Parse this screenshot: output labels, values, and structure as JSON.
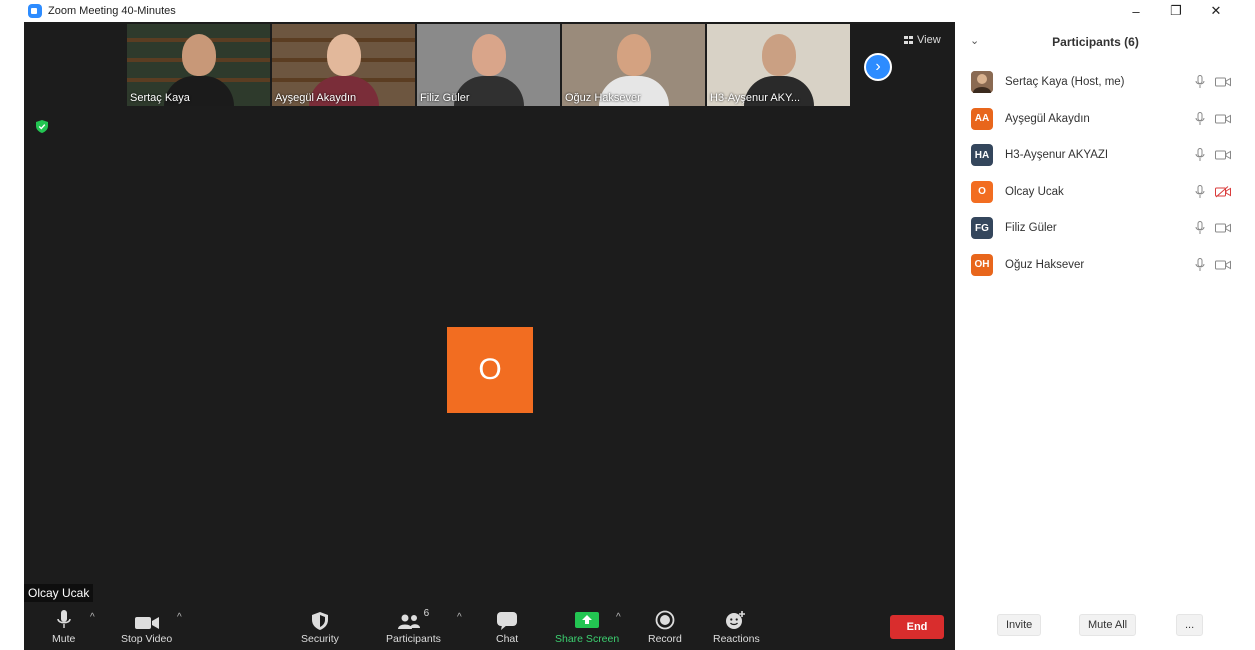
{
  "window": {
    "title": "Zoom Meeting 40-Minutes",
    "controls": [
      "–",
      "❐",
      "✕"
    ]
  },
  "gallery": {
    "tiles": [
      {
        "name": "Sertaç Kaya",
        "bg": "#2e3a2c",
        "shirt": "#1b1b1b",
        "skin": "#c89878"
      },
      {
        "name": "Ayşegül Akaydın",
        "bg": "#6d5640",
        "shirt": "#7a2d39",
        "skin": "#e2b89b"
      },
      {
        "name": "Filiz Güler",
        "bg": "#8a8a8a",
        "shirt": "#303030",
        "skin": "#d9a58a"
      },
      {
        "name": "Oğuz Haksever",
        "bg": "#9a8b7b",
        "shirt": "#e6e6e6",
        "skin": "#d4a281"
      },
      {
        "name": "H3-Ayşenur AKY...",
        "bg": "#d8d2c6",
        "shirt": "#2a2a2a",
        "skin": "#caa083"
      }
    ],
    "view_label": "View"
  },
  "main_video": {
    "avatar_letter": "O",
    "avatar_color": "#f26d21",
    "speaker_name": "Olcay Ucak"
  },
  "toolbar": {
    "mute": "Mute",
    "stop_video": "Stop Video",
    "security": "Security",
    "participants": "Participants",
    "participants_count": "6",
    "chat": "Chat",
    "share_screen": "Share Screen",
    "record": "Record",
    "reactions": "Reactions",
    "end": "End"
  },
  "panel": {
    "title": "Participants (6)",
    "participants": [
      {
        "initials": "",
        "name": "Sertaç Kaya (Host, me)",
        "color": "#8a6a52",
        "video_off": false
      },
      {
        "initials": "AA",
        "name": "Ayşegül Akaydın",
        "color": "#e8661c",
        "video_off": false
      },
      {
        "initials": "HA",
        "name": "H3-Ayşenur AKYAZI",
        "color": "#34465c",
        "video_off": false
      },
      {
        "initials": "O",
        "name": "Olcay Ucak",
        "color": "#f26d21",
        "video_off": true
      },
      {
        "initials": "FG",
        "name": "Filiz Güler",
        "color": "#34465c",
        "video_off": false
      },
      {
        "initials": "OH",
        "name": "Oğuz Haksever",
        "color": "#e8661c",
        "video_off": false
      }
    ],
    "invite": "Invite",
    "mute_all": "Mute All",
    "more": "..."
  }
}
